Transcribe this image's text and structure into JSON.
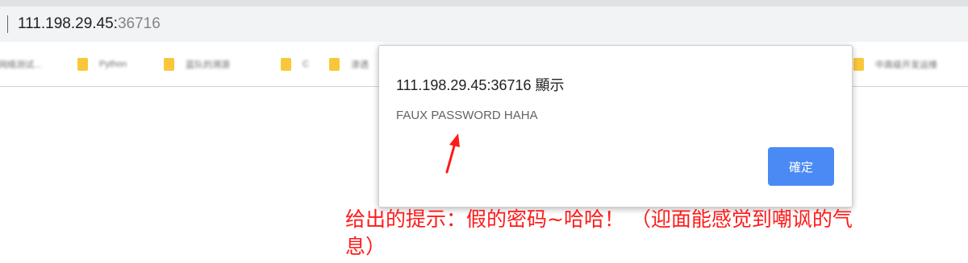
{
  "browser": {
    "url_host": "111.198.29.45:",
    "url_port": "36716",
    "bookmarks": [
      {
        "label": "网络测试...",
        "icon": "folder-icon"
      },
      {
        "label": "Python",
        "icon": "folder-icon"
      },
      {
        "label": "蓝队的溯源",
        "icon": "folder-icon"
      },
      {
        "label": "C",
        "icon": "folder-icon"
      },
      {
        "label": "渗透",
        "icon": "folder-icon"
      },
      {
        "label": "中高级开发运维",
        "icon": "folder-icon"
      }
    ]
  },
  "dialog": {
    "title": "111.198.29.45:36716 顯示",
    "message": "FAUX PASSWORD HAHA",
    "ok_label": "確定",
    "button_color": "#4a8af4"
  },
  "annotation": {
    "text": "给出的提示：假的密码~哈哈！ （迎面能感觉到嘲讽的气\n息）",
    "color": "#ff1a1a",
    "arrow_icon": "red-arrow-icon"
  }
}
